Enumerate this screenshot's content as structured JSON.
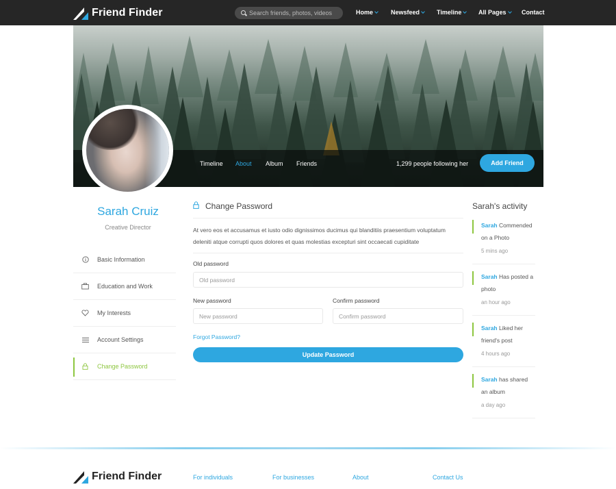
{
  "navbar": {
    "brand": "Friend Finder",
    "search_placeholder": "Search friends, photos, videos",
    "menu": [
      {
        "label": "Home",
        "dropdown": true
      },
      {
        "label": "Newsfeed",
        "dropdown": true
      },
      {
        "label": "Timeline",
        "dropdown": true
      },
      {
        "label": "All Pages",
        "dropdown": true
      },
      {
        "label": "Contact",
        "dropdown": false
      }
    ]
  },
  "cover": {
    "tabs": [
      "Timeline",
      "About",
      "Album",
      "Friends"
    ],
    "active_tab": "About",
    "followers": "1,299 people following her",
    "add_friend": "Add Friend"
  },
  "profile": {
    "name": "Sarah Cruiz",
    "role": "Creative Director",
    "menu": [
      {
        "label": "Basic Information",
        "icon": "info-icon"
      },
      {
        "label": "Education and Work",
        "icon": "briefcase-icon"
      },
      {
        "label": "My Interests",
        "icon": "heart-icon"
      },
      {
        "label": "Account Settings",
        "icon": "menu-icon"
      },
      {
        "label": "Change Password",
        "icon": "lock-icon",
        "active": true
      }
    ]
  },
  "form": {
    "title": "Change Password",
    "description": "At vero eos et accusamus et iusto odio dignissimos ducimus qui blanditiis praesentium voluptatum deleniti atque corrupti quos dolores et quas molestias excepturi sint occaecati cupiditate",
    "old_label": "Old password",
    "old_placeholder": "Old password",
    "new_label": "New password",
    "new_placeholder": "New password",
    "confirm_label": "Confirm password",
    "confirm_placeholder": "Confirm password",
    "forgot": "Forgot Password?",
    "submit": "Update Password"
  },
  "activity": {
    "title": "Sarah's activity",
    "items": [
      {
        "who": "Sarah",
        "text": " Commended on a Photo",
        "time": "5 mins ago"
      },
      {
        "who": "Sarah",
        "text": " Has posted a photo",
        "time": "an hour ago"
      },
      {
        "who": "Sarah",
        "text": " Liked her friend's post",
        "time": "4 hours ago"
      },
      {
        "who": "Sarah",
        "text": " has shared an album",
        "time": "a day ago"
      }
    ]
  },
  "footer": {
    "brand": "Friend Finder",
    "links": [
      "For individuals",
      "For businesses",
      "About",
      "Contact Us"
    ]
  },
  "colors": {
    "accent": "#2ea7e0",
    "active_green": "#8dc63f",
    "navbar_bg": "#262626"
  }
}
